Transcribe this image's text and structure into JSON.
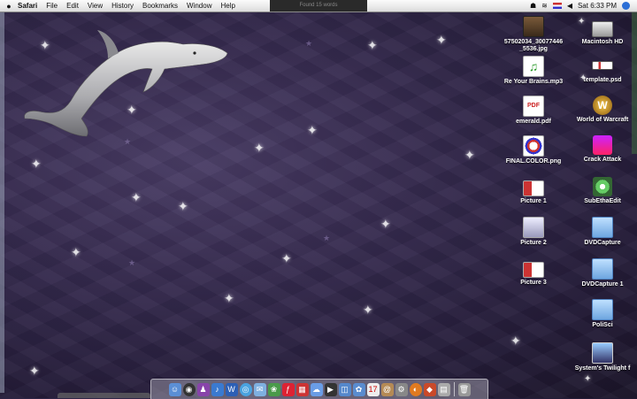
{
  "menubar": {
    "apple_label": "",
    "app_name": "Safari",
    "menus": [
      "File",
      "Edit",
      "View",
      "History",
      "Bookmarks",
      "Window",
      "Help"
    ],
    "window_title_hint": "Found 15 words",
    "clock": "Sat 6:33 PM",
    "icons": [
      "script-icon",
      "wifi-icon",
      "flag-icon",
      "volume-icon",
      "spotlight-icon"
    ]
  },
  "desktop_icons": [
    {
      "label": "57502034_30077446 _5536.jpg",
      "kind": "image"
    },
    {
      "label": "Macintosh HD",
      "kind": "harddrive"
    },
    {
      "label": "Re Your Brains.mp3",
      "kind": "audio"
    },
    {
      "label": "template.psd",
      "kind": "image"
    },
    {
      "label": "emerald.pdf",
      "kind": "pdf"
    },
    {
      "label": "World of Warcraft",
      "kind": "app"
    },
    {
      "label": "FINAL.COLOR.png",
      "kind": "image"
    },
    {
      "label": "Crack Attack",
      "kind": "app"
    },
    {
      "label": "Picture 1",
      "kind": "image"
    },
    {
      "label": "SubEthaEdit",
      "kind": "app"
    },
    {
      "label": "Picture 2",
      "kind": "image"
    },
    {
      "label": "DVDCapture",
      "kind": "folder"
    },
    {
      "label": "Picture 3",
      "kind": "image"
    },
    {
      "label": "DVDCapture 1",
      "kind": "folder"
    },
    {
      "label": "PoliSci",
      "kind": "folder"
    },
    {
      "label": "System's Twilight f",
      "kind": "app"
    }
  ],
  "dock": {
    "items": [
      "finder-icon",
      "dashboard-icon",
      "user-icon",
      "itunes-icon",
      "word-icon",
      "safari-icon",
      "mail-icon",
      "photo-icon",
      "flash-icon",
      "ical-icon",
      "ichat-icon",
      "imovie-icon",
      "preview-icon",
      "iphoto-icon",
      "calendar-icon",
      "address-icon",
      "sysprefs-icon",
      "firefox-icon",
      "sub-icon",
      "misc-icon",
      "trash-icon"
    ]
  },
  "colors": {
    "wallpaper": "#34294d",
    "menubar": "#eeeeee"
  }
}
